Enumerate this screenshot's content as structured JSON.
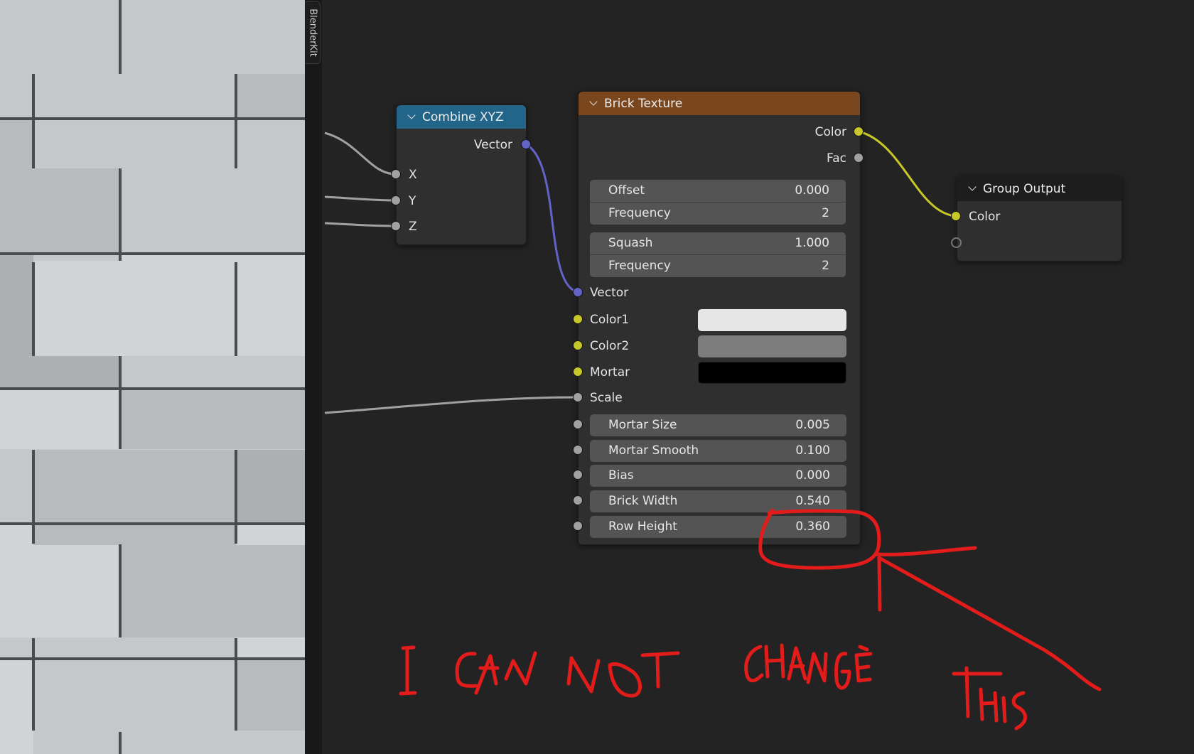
{
  "sidebar_tab": {
    "label": "BlenderKit"
  },
  "viewport": {
    "description": "brick texture preview",
    "brick_colors": [
      "#c6c7c8",
      "#d2d3d4",
      "#b9babb",
      "#aeafb0"
    ],
    "mortar_color": "#4a4b4d"
  },
  "nodes": {
    "combine_xyz": {
      "title": "Combine XYZ",
      "header_color": "#236489",
      "outputs": [
        {
          "label": "Vector",
          "type": "vector"
        }
      ],
      "inputs": [
        {
          "label": "X"
        },
        {
          "label": "Y"
        },
        {
          "label": "Z"
        }
      ]
    },
    "brick_texture": {
      "title": "Brick Texture",
      "header_color": "#7a461e",
      "outputs": [
        {
          "label": "Color",
          "type": "color"
        },
        {
          "label": "Fac",
          "type": "float"
        }
      ],
      "offset_group": [
        {
          "label": "Offset",
          "value": "0.000"
        },
        {
          "label": "Frequency",
          "value": "2"
        }
      ],
      "squash_group": [
        {
          "label": "Squash",
          "value": "1.000"
        },
        {
          "label": "Frequency",
          "value": "2"
        }
      ],
      "vector_input": {
        "label": "Vector"
      },
      "color_inputs": [
        {
          "label": "Color1",
          "swatch": "#e6e6e6"
        },
        {
          "label": "Color2",
          "swatch": "#7c7c7c"
        },
        {
          "label": "Mortar",
          "swatch": "#000000"
        }
      ],
      "scale_input": {
        "label": "Scale"
      },
      "params": [
        {
          "label": "Mortar Size",
          "value": "0.005"
        },
        {
          "label": "Mortar Smooth",
          "value": "0.100"
        },
        {
          "label": "Bias",
          "value": "0.000"
        },
        {
          "label": "Brick Width",
          "value": "0.540"
        },
        {
          "label": "Row Height",
          "value": "0.360"
        }
      ]
    },
    "group_output": {
      "title": "Group Output",
      "header_color": "#1d1d1d",
      "inputs": [
        {
          "label": "Color",
          "type": "color"
        },
        {
          "label": "",
          "type": "empty"
        }
      ]
    }
  },
  "link_colors": {
    "float": "#a1a1a1",
    "vector": "#6363c7",
    "color": "#c7c729"
  },
  "annotation": {
    "text": "I CAN NOT CHANGE THIS",
    "color": "#e21b1b",
    "target": "Row Height value"
  }
}
